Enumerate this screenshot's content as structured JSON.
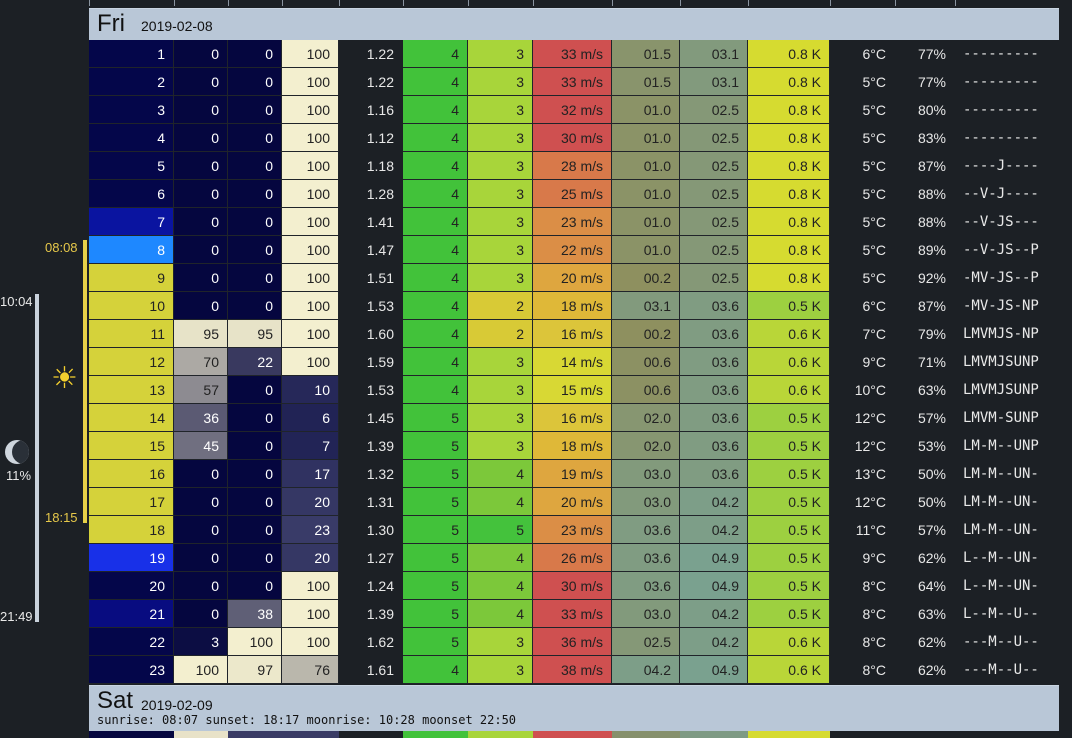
{
  "day1": {
    "name": "Fri",
    "date": "2019-02-08"
  },
  "day2": {
    "name": "Sat",
    "date": "2019-02-09",
    "info": "sunrise: 08:07 sunset: 18:17 moonrise: 10:28 moonset 22:50"
  },
  "left_axis": {
    "sunrise": "08:08",
    "sunset": "18:15",
    "moonrise": "10:04",
    "moonset": "21:49",
    "moon_illumination": "11%",
    "sun_icon": "sun-icon",
    "moon_icon": "moon-phase-icon"
  },
  "hours": [
    {
      "h": "1",
      "c1": "0",
      "c2": "0",
      "c3": "100",
      "v": "1.22",
      "a": "4",
      "b": "3",
      "wind": "33 m/s",
      "p1": "01.5",
      "p2": "03.1",
      "k": "0.8 K",
      "temp": "6°C",
      "hum": "77%",
      "code": "---------"
    },
    {
      "h": "2",
      "c1": "0",
      "c2": "0",
      "c3": "100",
      "v": "1.22",
      "a": "4",
      "b": "3",
      "wind": "33 m/s",
      "p1": "01.5",
      "p2": "03.1",
      "k": "0.8 K",
      "temp": "5°C",
      "hum": "77%",
      "code": "---------"
    },
    {
      "h": "3",
      "c1": "0",
      "c2": "0",
      "c3": "100",
      "v": "1.16",
      "a": "4",
      "b": "3",
      "wind": "32 m/s",
      "p1": "01.0",
      "p2": "02.5",
      "k": "0.8 K",
      "temp": "5°C",
      "hum": "80%",
      "code": "---------"
    },
    {
      "h": "4",
      "c1": "0",
      "c2": "0",
      "c3": "100",
      "v": "1.12",
      "a": "4",
      "b": "3",
      "wind": "30 m/s",
      "p1": "01.0",
      "p2": "02.5",
      "k": "0.8 K",
      "temp": "5°C",
      "hum": "83%",
      "code": "---------"
    },
    {
      "h": "5",
      "c1": "0",
      "c2": "0",
      "c3": "100",
      "v": "1.18",
      "a": "4",
      "b": "3",
      "wind": "28 m/s",
      "p1": "01.0",
      "p2": "02.5",
      "k": "0.8 K",
      "temp": "5°C",
      "hum": "87%",
      "code": "----J----"
    },
    {
      "h": "6",
      "c1": "0",
      "c2": "0",
      "c3": "100",
      "v": "1.28",
      "a": "4",
      "b": "3",
      "wind": "25 m/s",
      "p1": "01.0",
      "p2": "02.5",
      "k": "0.8 K",
      "temp": "5°C",
      "hum": "88%",
      "code": "--V-J----"
    },
    {
      "h": "7",
      "c1": "0",
      "c2": "0",
      "c3": "100",
      "v": "1.41",
      "a": "4",
      "b": "3",
      "wind": "23 m/s",
      "p1": "01.0",
      "p2": "02.5",
      "k": "0.8 K",
      "temp": "5°C",
      "hum": "88%",
      "code": "--V-JS---"
    },
    {
      "h": "8",
      "c1": "0",
      "c2": "0",
      "c3": "100",
      "v": "1.47",
      "a": "4",
      "b": "3",
      "wind": "22 m/s",
      "p1": "01.0",
      "p2": "02.5",
      "k": "0.8 K",
      "temp": "5°C",
      "hum": "89%",
      "code": "--V-JS--P"
    },
    {
      "h": "9",
      "c1": "0",
      "c2": "0",
      "c3": "100",
      "v": "1.51",
      "a": "4",
      "b": "3",
      "wind": "20 m/s",
      "p1": "00.2",
      "p2": "02.5",
      "k": "0.8 K",
      "temp": "5°C",
      "hum": "92%",
      "code": "-MV-JS--P"
    },
    {
      "h": "10",
      "c1": "0",
      "c2": "0",
      "c3": "100",
      "v": "1.53",
      "a": "4",
      "b": "2",
      "wind": "18 m/s",
      "p1": "03.1",
      "p2": "03.6",
      "k": "0.5 K",
      "temp": "6°C",
      "hum": "87%",
      "code": "-MV-JS-NP"
    },
    {
      "h": "11",
      "c1": "95",
      "c2": "95",
      "c3": "100",
      "v": "1.60",
      "a": "4",
      "b": "2",
      "wind": "16 m/s",
      "p1": "00.2",
      "p2": "03.6",
      "k": "0.6 K",
      "temp": "7°C",
      "hum": "79%",
      "code": "LMVMJS-NP"
    },
    {
      "h": "12",
      "c1": "70",
      "c2": "22",
      "c3": "100",
      "v": "1.59",
      "a": "4",
      "b": "3",
      "wind": "14 m/s",
      "p1": "00.6",
      "p2": "03.6",
      "k": "0.6 K",
      "temp": "9°C",
      "hum": "71%",
      "code": "LMVMJSUNP"
    },
    {
      "h": "13",
      "c1": "57",
      "c2": "0",
      "c3": "10",
      "v": "1.53",
      "a": "4",
      "b": "3",
      "wind": "15 m/s",
      "p1": "00.6",
      "p2": "03.6",
      "k": "0.6 K",
      "temp": "10°C",
      "hum": "63%",
      "code": "LMVMJSUNP"
    },
    {
      "h": "14",
      "c1": "36",
      "c2": "0",
      "c3": "6",
      "v": "1.45",
      "a": "5",
      "b": "3",
      "wind": "16 m/s",
      "p1": "02.0",
      "p2": "03.6",
      "k": "0.5 K",
      "temp": "12°C",
      "hum": "57%",
      "code": "LMVM-SUNP"
    },
    {
      "h": "15",
      "c1": "45",
      "c2": "0",
      "c3": "7",
      "v": "1.39",
      "a": "5",
      "b": "3",
      "wind": "18 m/s",
      "p1": "02.0",
      "p2": "03.6",
      "k": "0.5 K",
      "temp": "12°C",
      "hum": "53%",
      "code": "LM-M--UNP"
    },
    {
      "h": "16",
      "c1": "0",
      "c2": "0",
      "c3": "17",
      "v": "1.32",
      "a": "5",
      "b": "4",
      "wind": "19 m/s",
      "p1": "03.0",
      "p2": "03.6",
      "k": "0.5 K",
      "temp": "13°C",
      "hum": "50%",
      "code": "LM-M--UN-"
    },
    {
      "h": "17",
      "c1": "0",
      "c2": "0",
      "c3": "20",
      "v": "1.31",
      "a": "5",
      "b": "4",
      "wind": "20 m/s",
      "p1": "03.0",
      "p2": "04.2",
      "k": "0.5 K",
      "temp": "12°C",
      "hum": "50%",
      "code": "LM-M--UN-"
    },
    {
      "h": "18",
      "c1": "0",
      "c2": "0",
      "c3": "23",
      "v": "1.30",
      "a": "5",
      "b": "5",
      "wind": "23 m/s",
      "p1": "03.6",
      "p2": "04.2",
      "k": "0.5 K",
      "temp": "11°C",
      "hum": "57%",
      "code": "LM-M--UN-"
    },
    {
      "h": "19",
      "c1": "0",
      "c2": "0",
      "c3": "20",
      "v": "1.27",
      "a": "5",
      "b": "4",
      "wind": "26 m/s",
      "p1": "03.6",
      "p2": "04.9",
      "k": "0.5 K",
      "temp": "9°C",
      "hum": "62%",
      "code": "L--M--UN-"
    },
    {
      "h": "20",
      "c1": "0",
      "c2": "0",
      "c3": "100",
      "v": "1.24",
      "a": "5",
      "b": "4",
      "wind": "30 m/s",
      "p1": "03.6",
      "p2": "04.9",
      "k": "0.5 K",
      "temp": "8°C",
      "hum": "64%",
      "code": "L--M--UN-"
    },
    {
      "h": "21",
      "c1": "0",
      "c2": "38",
      "c3": "100",
      "v": "1.39",
      "a": "5",
      "b": "4",
      "wind": "33 m/s",
      "p1": "03.0",
      "p2": "04.2",
      "k": "0.5 K",
      "temp": "8°C",
      "hum": "63%",
      "code": "L--M--U--"
    },
    {
      "h": "22",
      "c1": "3",
      "c2": "100",
      "c3": "100",
      "v": "1.62",
      "a": "5",
      "b": "3",
      "wind": "36 m/s",
      "p1": "02.5",
      "p2": "04.2",
      "k": "0.6 K",
      "temp": "8°C",
      "hum": "62%",
      "code": "---M--U--"
    },
    {
      "h": "23",
      "c1": "100",
      "c2": "97",
      "c3": "76",
      "v": "1.61",
      "a": "4",
      "b": "3",
      "wind": "38 m/s",
      "p1": "04.2",
      "p2": "04.9",
      "k": "0.6 K",
      "temp": "8°C",
      "hum": "62%",
      "code": "---M--U--"
    }
  ],
  "colors": {
    "hour_daylight": "#d5d23a",
    "hour_night": "#04064a",
    "hour_highlight": "#1e88ff",
    "header_bg": "#b9c7d7",
    "cloud_low_clear": "#05063f",
    "a_green": "#42c23a",
    "b_green": "#a8d53a",
    "wind_red": "#cf5050",
    "wind_orange": "#dd9944",
    "wind_yellow": "#d8d834",
    "k_yellow": "#d6db30",
    "k_green": "#9dd040"
  }
}
